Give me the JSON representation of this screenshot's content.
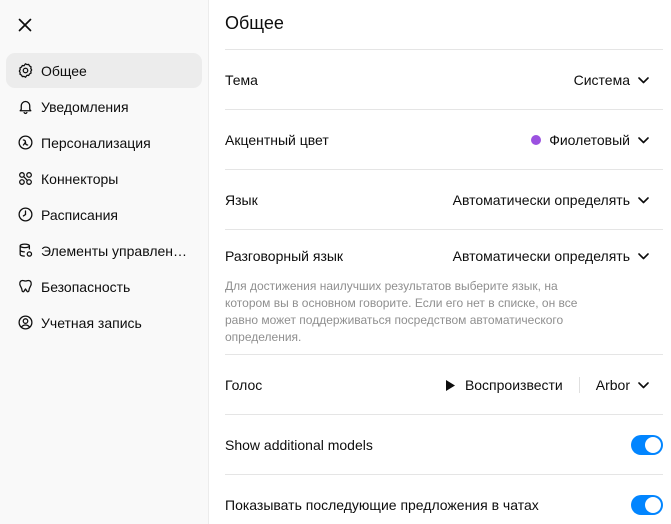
{
  "sidebar": {
    "close_icon": "close-icon",
    "items": [
      {
        "label": "Общее",
        "icon": "gear-icon",
        "active": true
      },
      {
        "label": "Уведомления",
        "icon": "bell-icon"
      },
      {
        "label": "Персонализация",
        "icon": "personalization-icon"
      },
      {
        "label": "Коннекторы",
        "icon": "connectors-icon"
      },
      {
        "label": "Расписания",
        "icon": "clock-icon"
      },
      {
        "label": "Элементы управления данными",
        "icon": "database-icon"
      },
      {
        "label": "Безопасность",
        "icon": "shield-icon"
      },
      {
        "label": "Учетная запись",
        "icon": "account-icon"
      }
    ]
  },
  "main": {
    "title": "Общее",
    "theme": {
      "label": "Тема",
      "value": "Система"
    },
    "accent": {
      "label": "Акцентный цвет",
      "value": "Фиолетовый",
      "color": "#9b51e0"
    },
    "language": {
      "label": "Язык",
      "value": "Автоматически определять"
    },
    "spoken_language": {
      "label": "Разговорный язык",
      "value": "Автоматически определять",
      "hint": "Для достижения наилучших результатов выберите язык, на котором вы в основном говорите. Если его нет в списке, он все равно может поддерживаться посредством автоматического определения."
    },
    "voice": {
      "label": "Голос",
      "play_label": "Воспроизвести",
      "value": "Arbor"
    },
    "additional_models": {
      "label": "Show additional models",
      "enabled": true
    },
    "follow_up": {
      "label": "Показывать последующие предложения в чатах",
      "enabled": true
    }
  },
  "colors": {
    "toggle_on": "#0285ff",
    "sidebar_bg": "#f9f9f9",
    "active_item": "#ececec"
  }
}
